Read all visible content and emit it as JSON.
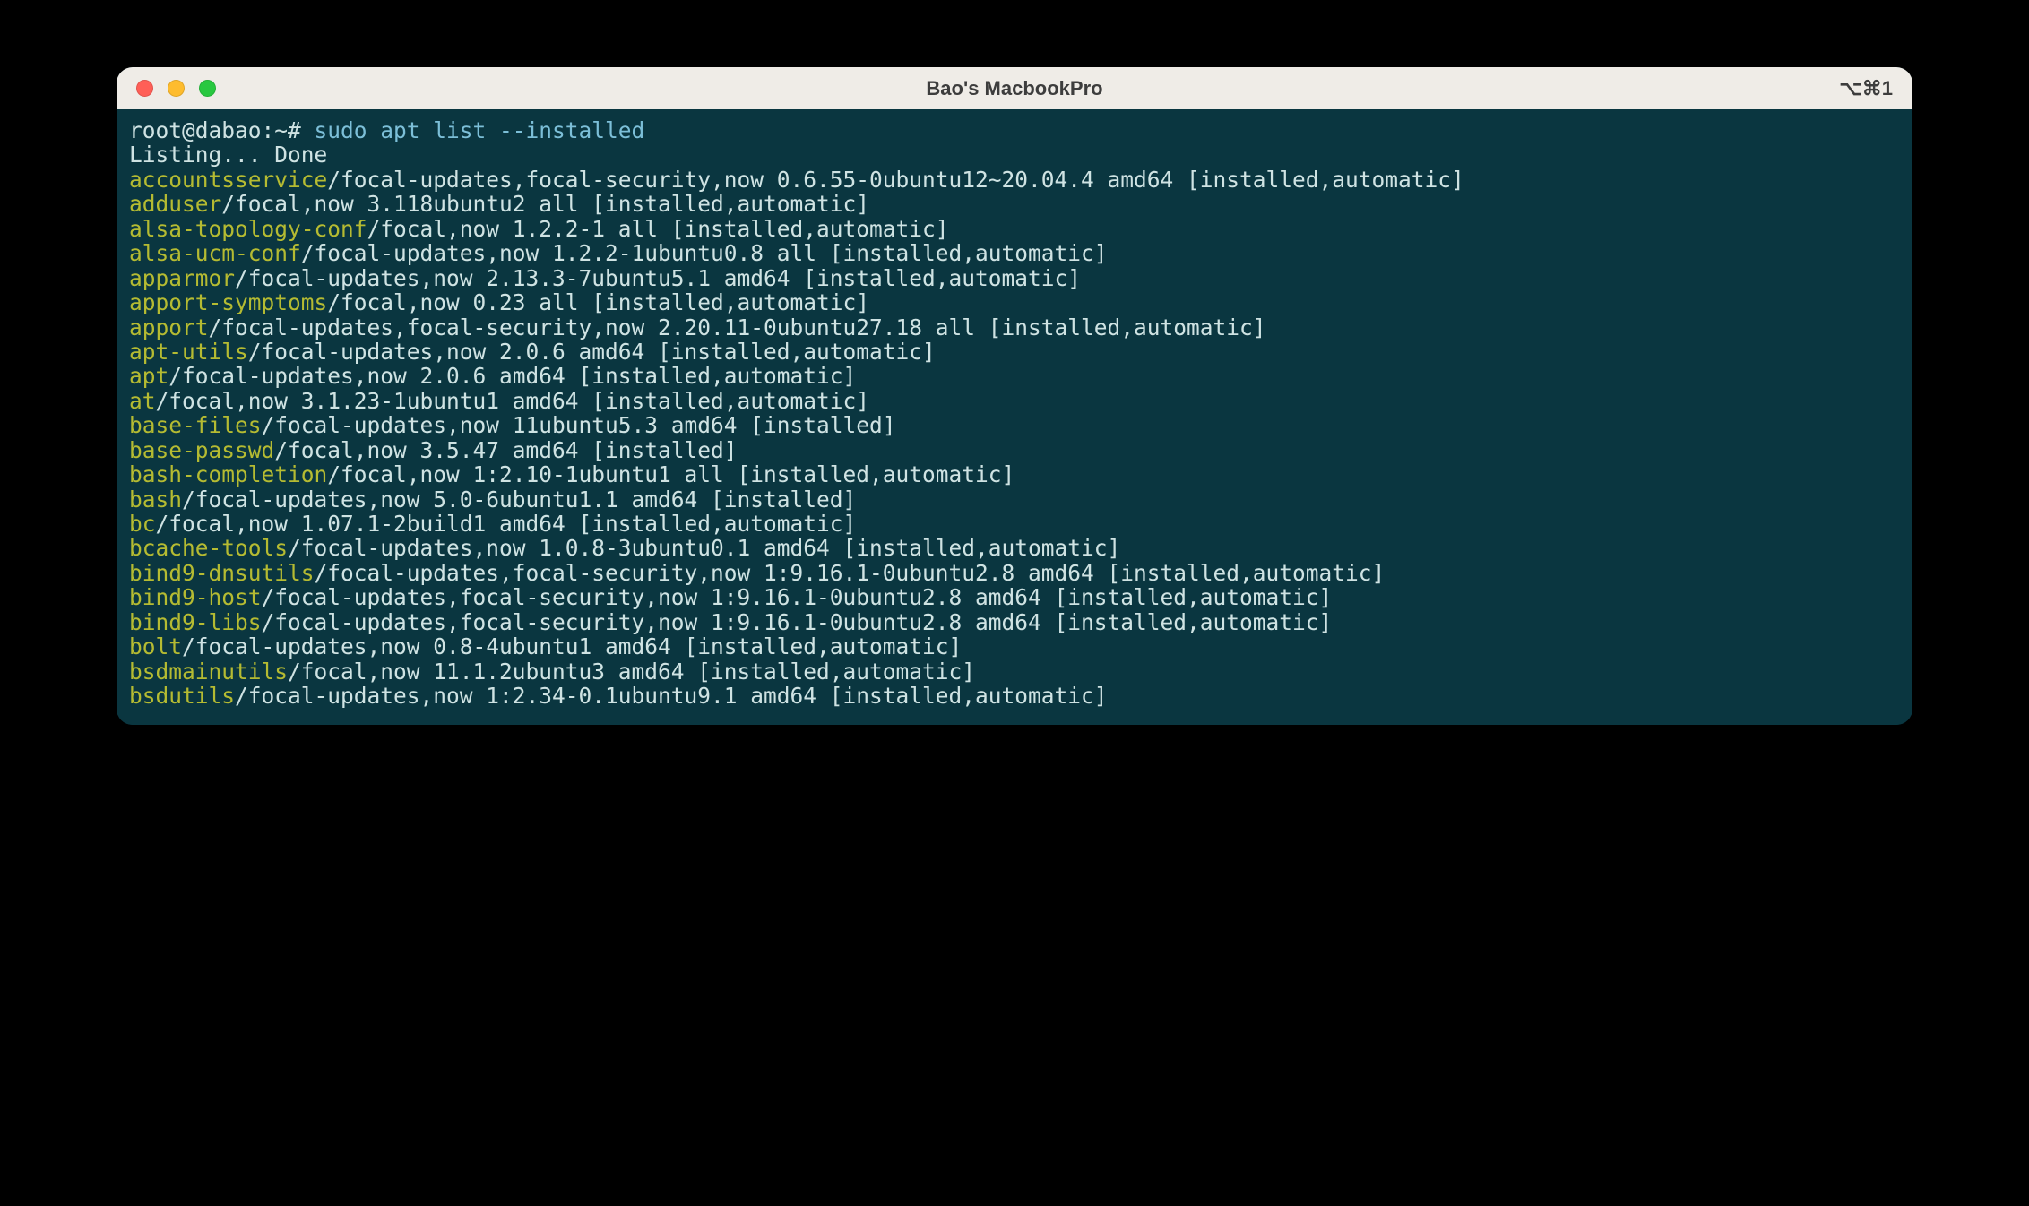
{
  "window": {
    "title": "Bao's MacbookPro",
    "tab_hint": "⌥⌘1"
  },
  "term": {
    "prompt": "root@dabao:~# ",
    "command": "sudo apt list --installed",
    "listing_line": "Listing... Done",
    "packages": [
      {
        "name": "accountsservice",
        "rest": "/focal-updates,focal-security,now 0.6.55-0ubuntu12~20.04.4 amd64 [installed,automatic]"
      },
      {
        "name": "adduser",
        "rest": "/focal,now 3.118ubuntu2 all [installed,automatic]"
      },
      {
        "name": "alsa-topology-conf",
        "rest": "/focal,now 1.2.2-1 all [installed,automatic]"
      },
      {
        "name": "alsa-ucm-conf",
        "rest": "/focal-updates,now 1.2.2-1ubuntu0.8 all [installed,automatic]"
      },
      {
        "name": "apparmor",
        "rest": "/focal-updates,now 2.13.3-7ubuntu5.1 amd64 [installed,automatic]"
      },
      {
        "name": "apport-symptoms",
        "rest": "/focal,now 0.23 all [installed,automatic]"
      },
      {
        "name": "apport",
        "rest": "/focal-updates,focal-security,now 2.20.11-0ubuntu27.18 all [installed,automatic]"
      },
      {
        "name": "apt-utils",
        "rest": "/focal-updates,now 2.0.6 amd64 [installed,automatic]"
      },
      {
        "name": "apt",
        "rest": "/focal-updates,now 2.0.6 amd64 [installed,automatic]"
      },
      {
        "name": "at",
        "rest": "/focal,now 3.1.23-1ubuntu1 amd64 [installed,automatic]"
      },
      {
        "name": "base-files",
        "rest": "/focal-updates,now 11ubuntu5.3 amd64 [installed]"
      },
      {
        "name": "base-passwd",
        "rest": "/focal,now 3.5.47 amd64 [installed]"
      },
      {
        "name": "bash-completion",
        "rest": "/focal,now 1:2.10-1ubuntu1 all [installed,automatic]"
      },
      {
        "name": "bash",
        "rest": "/focal-updates,now 5.0-6ubuntu1.1 amd64 [installed]"
      },
      {
        "name": "bc",
        "rest": "/focal,now 1.07.1-2build1 amd64 [installed,automatic]"
      },
      {
        "name": "bcache-tools",
        "rest": "/focal-updates,now 1.0.8-3ubuntu0.1 amd64 [installed,automatic]"
      },
      {
        "name": "bind9-dnsutils",
        "rest": "/focal-updates,focal-security,now 1:9.16.1-0ubuntu2.8 amd64 [installed,automatic]"
      },
      {
        "name": "bind9-host",
        "rest": "/focal-updates,focal-security,now 1:9.16.1-0ubuntu2.8 amd64 [installed,automatic]"
      },
      {
        "name": "bind9-libs",
        "rest": "/focal-updates,focal-security,now 1:9.16.1-0ubuntu2.8 amd64 [installed,automatic]"
      },
      {
        "name": "bolt",
        "rest": "/focal-updates,now 0.8-4ubuntu1 amd64 [installed,automatic]"
      },
      {
        "name": "bsdmainutils",
        "rest": "/focal,now 11.1.2ubuntu3 amd64 [installed,automatic]"
      },
      {
        "name": "bsdutils",
        "rest": "/focal-updates,now 1:2.34-0.1ubuntu9.1 amd64 [installed,automatic]"
      }
    ]
  }
}
